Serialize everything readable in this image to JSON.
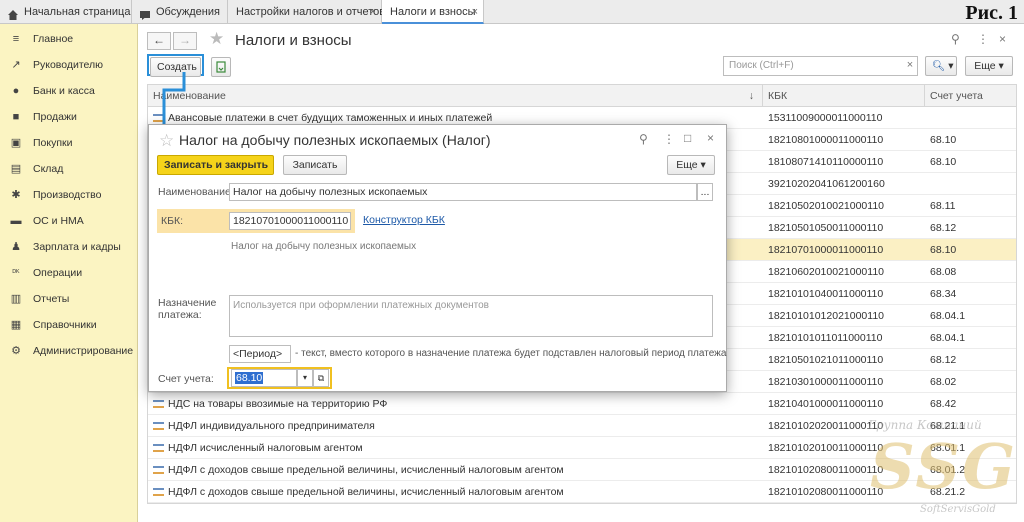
{
  "figure_label": "Рис. 1",
  "tabs": [
    {
      "label": "Начальная страница",
      "icon": "home-icon"
    },
    {
      "label": "Обсуждения",
      "icon": "chat-icon"
    },
    {
      "label": "Настройки налогов и отчетов"
    },
    {
      "label": "Налоги и взносы",
      "active": true
    }
  ],
  "sidebar": {
    "items": [
      {
        "label": "Главное",
        "icon": "menu-icon"
      },
      {
        "label": "Руководителю",
        "icon": "trend-icon"
      },
      {
        "label": "Банк и касса",
        "icon": "coin-icon"
      },
      {
        "label": "Продажи",
        "icon": "bag-icon"
      },
      {
        "label": "Покупки",
        "icon": "cart-icon"
      },
      {
        "label": "Склад",
        "icon": "warehouse-icon"
      },
      {
        "label": "Производство",
        "icon": "gear-icon"
      },
      {
        "label": "ОС и НМА",
        "icon": "truck-icon"
      },
      {
        "label": "Зарплата и кадры",
        "icon": "people-icon"
      },
      {
        "label": "Операции",
        "icon": "operations-icon"
      },
      {
        "label": "Отчеты",
        "icon": "bar-chart-icon"
      },
      {
        "label": "Справочники",
        "icon": "book-icon"
      },
      {
        "label": "Администрирование",
        "icon": "settings-icon"
      }
    ]
  },
  "list": {
    "title": "Налоги и взносы",
    "create_label": "Создать",
    "search_placeholder": "Поиск (Ctrl+F)",
    "more_label": "Еще",
    "columns": [
      "Наименование",
      "КБК",
      "Счет учета"
    ],
    "rows": [
      {
        "name": "Авансовые платежи в счет будущих таможенных и иных платежей",
        "kbk": "15311009000011000110",
        "account": ""
      },
      {
        "name": "",
        "kbk": "18210801000011000110",
        "account": "68.10"
      },
      {
        "name": "",
        "kbk": "18108071410110000110",
        "account": "68.10"
      },
      {
        "name": "",
        "kbk": "39210202041061200160",
        "account": ""
      },
      {
        "name": "",
        "kbk": "18210502010021000110",
        "account": "68.11"
      },
      {
        "name": "",
        "kbk": "18210501050011000110",
        "account": "68.12"
      },
      {
        "name": "",
        "kbk": "18210701000011000110",
        "account": "68.10",
        "selected": true
      },
      {
        "name": "",
        "kbk": "18210602010021000110",
        "account": "68.08"
      },
      {
        "name": "",
        "kbk": "18210101040011000110",
        "account": "68.34"
      },
      {
        "name": "",
        "kbk": "18210101012021000110",
        "account": "68.04.1"
      },
      {
        "name": "",
        "kbk": "18210101011011000110",
        "account": "68.04.1"
      },
      {
        "name": "",
        "kbk": "18210501021011000110",
        "account": "68.12"
      },
      {
        "name": "",
        "kbk": "18210301000011000110",
        "account": "68.02"
      },
      {
        "name": "НДС на товары ввозимые на территорию РФ",
        "kbk": "18210401000011000110",
        "account": "68.42"
      },
      {
        "name": "НДФЛ индивидуального предпринимателя",
        "kbk": "18210102020011000110",
        "account": "68.21.1"
      },
      {
        "name": "НДФЛ исчисленный налоговым агентом",
        "kbk": "18210102010011000110",
        "account": "68.01.1"
      },
      {
        "name": "НДФЛ с доходов свыше предельной величины, исчисленный налоговым агентом",
        "kbk": "18210102080011000110",
        "account": "68.01.2"
      },
      {
        "name": "НДФЛ с доходов свыше предельной величины, исчисленный налоговым агентом",
        "kbk": "18210102080011000110",
        "account": "68.21.2"
      }
    ]
  },
  "modal": {
    "title": "Налог на добычу полезных ископаемых (Налог)",
    "save_close_label": "Записать и закрыть",
    "save_label": "Записать",
    "more_label": "Еще",
    "name_label": "Наименование:",
    "name_value": "Налог на добычу полезных ископаемых",
    "ellipsis": "...",
    "kbk_label": "КБК:",
    "kbk_value": "18210701000011000110",
    "kbk_link": "Конструктор КБК",
    "kbk_hint": "Налог на добычу полезных ископаемых",
    "purpose_label_1": "Назначение",
    "purpose_label_2": "платежа:",
    "purpose_placeholder": "Используется при оформлении платежных документов",
    "period_value": "<Период>",
    "period_hint": "- текст, вместо которого в назначение платежа будет подставлен налоговый период платежа",
    "account_label": "Счет учета:",
    "account_value": "68.10"
  },
  "watermark": {
    "top": "Группа Компаний",
    "big": "SSG",
    "bottom": "SoftServisGold"
  },
  "colors": {
    "sidebar_bg": "#fbf4c2",
    "accent": "#2a8fd8",
    "selected_row": "#fbf0c4",
    "primary_button": "#f5d31a"
  }
}
